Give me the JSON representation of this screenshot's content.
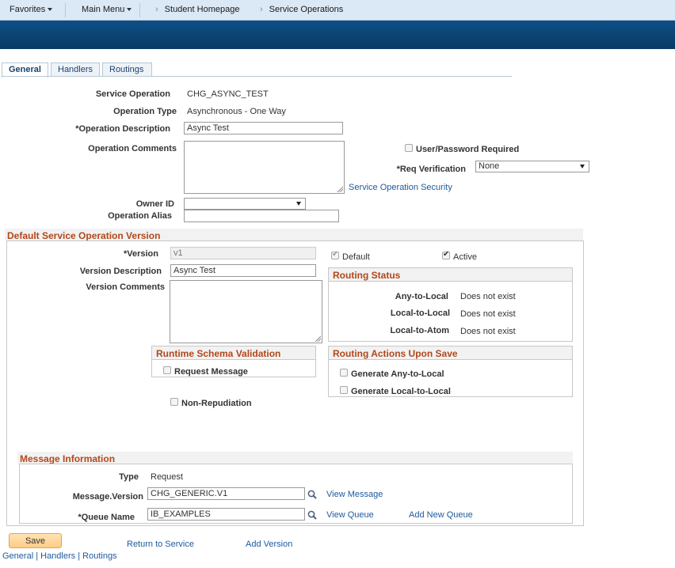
{
  "topnav": {
    "favorites": "Favorites",
    "main_menu": "Main Menu",
    "breadcrumb": [
      "Student Homepage",
      "Service Operations"
    ]
  },
  "tabs": [
    "General",
    "Handlers",
    "Routings"
  ],
  "general": {
    "service_operation_label": "Service Operation",
    "service_operation_value": "CHG_ASYNC_TEST",
    "operation_type_label": "Operation Type",
    "operation_type_value": "Asynchronous - One Way",
    "operation_description_label": "*Operation Description",
    "operation_description_value": "Async Test",
    "operation_comments_label": "Operation Comments",
    "user_password_label": "User/Password Required",
    "req_verification_label": "*Req Verification",
    "req_verification_value": "None",
    "service_operation_security_link": "Service Operation Security",
    "owner_id_label": "Owner ID",
    "owner_id_value": "",
    "operation_alias_label": "Operation Alias",
    "operation_alias_value": ""
  },
  "version": {
    "section_title": "Default Service Operation Version",
    "version_label": "*Version",
    "version_value": "v1",
    "default_label": "Default",
    "active_label": "Active",
    "version_description_label": "Version Description",
    "version_description_value": "Async Test",
    "version_comments_label": "Version Comments",
    "routing_status_title": "Routing Status",
    "routing_status": [
      {
        "label": "Any-to-Local",
        "value": "Does not exist"
      },
      {
        "label": "Local-to-Local",
        "value": "Does not exist"
      },
      {
        "label": "Local-to-Atom",
        "value": "Does not exist"
      }
    ],
    "runtime_schema_title": "Runtime Schema Validation",
    "request_message_label": "Request Message",
    "routing_actions_title": "Routing Actions Upon Save",
    "generate_any_to_local_label": "Generate Any-to-Local",
    "generate_local_to_local_label": "Generate Local-to-Local",
    "non_repudiation_label": "Non-Repudiation"
  },
  "message": {
    "section_title": "Message Information",
    "type_label": "Type",
    "type_value": "Request",
    "message_version_label": "Message.Version",
    "message_version_value": "CHG_GENERIC.V1",
    "view_message_link": "View Message",
    "queue_name_label": "*Queue Name",
    "queue_name_value": "IB_EXAMPLES",
    "view_queue_link": "View Queue",
    "add_new_queue_link": "Add New Queue"
  },
  "footer": {
    "save_label": "Save",
    "return_to_service": "Return to Service",
    "add_version": "Add Version",
    "bottom_links": [
      "General",
      "Handlers",
      "Routings"
    ],
    "separator": " | "
  }
}
